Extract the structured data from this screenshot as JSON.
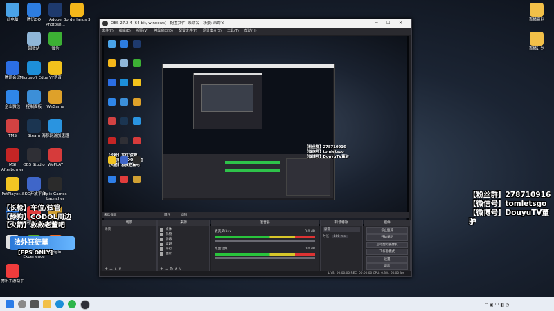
{
  "desktop": {
    "left_icons": [
      {
        "label": "此电脑",
        "color": "#4aa3e8"
      },
      {
        "label": "腾讯QQ",
        "color": "#2d7de0"
      },
      {
        "label": "Adobe Photosh...",
        "color": "#1e3a6d"
      },
      {
        "label": "Borderlands 3",
        "color": "#f4b71a"
      },
      {
        "label": "回收站",
        "color": "#8fb6d8"
      },
      {
        "label": "微信",
        "color": "#3cb034"
      },
      {
        "label": "腾讯会议",
        "color": "#2b6ee4"
      },
      {
        "label": "Microsoft Edge",
        "color": "#1d8fd9"
      },
      {
        "label": "YY语音",
        "color": "#f2c21c"
      },
      {
        "label": "企业微信",
        "color": "#2f86e9"
      },
      {
        "label": "控制面板",
        "color": "#3c8fd8"
      },
      {
        "label": "WeGame",
        "color": "#dea12a"
      },
      {
        "label": "TMS",
        "color": "#d24242"
      },
      {
        "label": "Steam",
        "color": "#1b3551"
      },
      {
        "label": "海豚网游加速器",
        "color": "#2a94e0"
      },
      {
        "label": "MSI Afterburner",
        "color": "#c52525"
      },
      {
        "label": "OBS Studio",
        "color": "#2f2f35"
      },
      {
        "label": "WePLAY",
        "color": "#d63b3b"
      },
      {
        "label": "PotPlayer...",
        "color": "#f3c523"
      },
      {
        "label": "SKG开放平台",
        "color": "#3f66c9"
      },
      {
        "label": "Epic Games Launcher",
        "color": "#2b2b2b"
      },
      {
        "label": "ToDesk",
        "color": "#2e7ee8"
      },
      {
        "label": "网络公司",
        "color": "#e03c3c"
      },
      {
        "label": "战斗...",
        "color": "#d0a033"
      },
      {
        "label": "",
        "color": "#e0e0e0"
      },
      {
        "label": "GeForce Experience",
        "color": "#5ab02a"
      },
      {
        "label": "Origin",
        "color": "#f06a25"
      },
      {
        "label": "腾讯手游助手",
        "color": "#f03c3c"
      }
    ],
    "right_icons": [
      {
        "label": "直播资料",
        "color": "#f2c048"
      },
      {
        "label": "直播计划",
        "color": "#f2c048"
      }
    ]
  },
  "overlay_right": {
    "line1": "【粉丝群】278710916",
    "line2": "【微信号】tomletsgo",
    "line3": "【微博号】DouyuTV董驴"
  },
  "overlay_left": {
    "line1": "【长枪】车位/弦管",
    "line2": "【舔狗】CODOL周边",
    "line3": "【火箭】救救老董吧",
    "badge": "法外狂徒董",
    "fps": "[FPS ONLY]"
  },
  "obs": {
    "title": "OBS 27.2.4 (64-bit, windows) - 配置文件: 未命名 - 场景: 未命名",
    "menu": [
      "文件(F)",
      "编辑(E)",
      "视图(V)",
      "停靠窗口(D)",
      "配置文件(P)",
      "场景集合(S)",
      "工具(T)",
      "帮助(H)"
    ],
    "strip_left": "未选择源",
    "strip_btn1": "属性",
    "strip_btn2": "滤镜",
    "scenes": {
      "header": "场景",
      "items": [
        "场景"
      ]
    },
    "sources": {
      "header": "来源",
      "items": [
        "媒体",
        "礼物",
        "弹幕",
        "穿越",
        "排行",
        "图片"
      ]
    },
    "mixer": {
      "header": "混音器",
      "track1": "麦克风/Aux",
      "track1_db": "0.0 dB",
      "track2": "桌面音频",
      "track2_db": "0.0 dB"
    },
    "transitions": {
      "header": "转场特效",
      "type": "渐变",
      "duration_label": "时长",
      "duration": "300 ms"
    },
    "controls": {
      "header": "控件",
      "buttons": [
        "停止推流",
        "开始录制",
        "启动虚拟摄像机",
        "工作室模式",
        "设置",
        "退出"
      ]
    },
    "status": "LIVE: 00:00:00    REC: 00:00:00    CPU: 0.3%, 60.00 fps"
  }
}
